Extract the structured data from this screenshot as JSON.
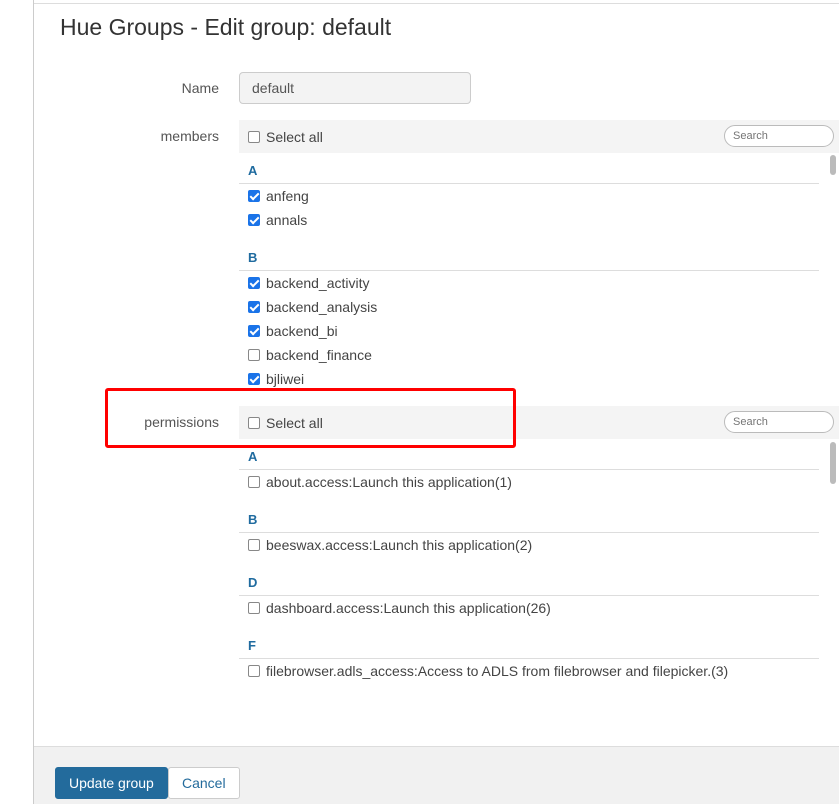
{
  "title": "Hue Groups - Edit group: default",
  "name": {
    "label": "Name",
    "value": "default"
  },
  "members": {
    "label": "members",
    "select_all": "Select all",
    "search_placeholder": "Search",
    "groups": [
      {
        "letter": "A",
        "items": [
          {
            "label": "anfeng",
            "checked": true
          },
          {
            "label": "annals",
            "checked": true
          }
        ]
      },
      {
        "letter": "B",
        "items": [
          {
            "label": "backend_activity",
            "checked": true
          },
          {
            "label": "backend_analysis",
            "checked": true
          },
          {
            "label": "backend_bi",
            "checked": true
          },
          {
            "label": "backend_finance",
            "checked": false
          },
          {
            "label": "bjliwei",
            "checked": true
          }
        ]
      }
    ]
  },
  "permissions": {
    "label": "permissions",
    "select_all": "Select all",
    "search_placeholder": "Search",
    "groups": [
      {
        "letter": "A",
        "items": [
          {
            "label": "about.access:Launch this application(1)",
            "checked": false
          }
        ]
      },
      {
        "letter": "B",
        "items": [
          {
            "label": "beeswax.access:Launch this application(2)",
            "checked": false
          }
        ]
      },
      {
        "letter": "D",
        "items": [
          {
            "label": "dashboard.access:Launch this application(26)",
            "checked": false
          }
        ]
      },
      {
        "letter": "F",
        "items": [
          {
            "label": "filebrowser.adls_access:Access to ADLS from filebrowser and filepicker.(3)",
            "checked": false
          }
        ]
      }
    ]
  },
  "footer": {
    "update": "Update group",
    "cancel": "Cancel"
  },
  "colors": {
    "primary": "#236b9c",
    "highlight": "#ff0000"
  }
}
